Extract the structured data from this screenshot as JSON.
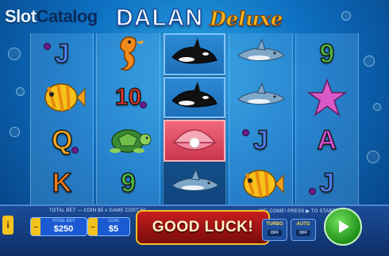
{
  "watermark": {
    "part1": "Slot",
    "part2": "Catalog"
  },
  "logo": {
    "main": "DALAN",
    "sub": "Deluxe"
  },
  "reels": [
    [
      {
        "symbol": "J",
        "type": "card",
        "class": "c-j"
      },
      {
        "symbol": "yellow-fish",
        "type": "pic"
      },
      {
        "symbol": "Q",
        "type": "card",
        "class": "c-q"
      },
      {
        "symbol": "K",
        "type": "card",
        "class": "c-k"
      }
    ],
    [
      {
        "symbol": "seahorse",
        "type": "pic"
      },
      {
        "symbol": "10",
        "type": "card",
        "class": "c-10"
      },
      {
        "symbol": "turtle",
        "type": "pic"
      },
      {
        "symbol": "9",
        "type": "card",
        "class": "c-9"
      }
    ],
    [
      {
        "symbol": "orca",
        "type": "pic"
      },
      {
        "symbol": "orca",
        "type": "pic"
      },
      {
        "symbol": "pearl-clam",
        "type": "pic"
      },
      {
        "symbol": "shark",
        "type": "pic"
      }
    ],
    [
      {
        "symbol": "shark",
        "type": "pic"
      },
      {
        "symbol": "shark",
        "type": "pic"
      },
      {
        "symbol": "J",
        "type": "card",
        "class": "c-j"
      },
      {
        "symbol": "yellow-fish",
        "type": "pic"
      }
    ],
    [
      {
        "symbol": "9",
        "type": "card",
        "class": "c-9"
      },
      {
        "symbol": "starfish",
        "type": "pic"
      },
      {
        "symbol": "A",
        "type": "card",
        "class": "c-a"
      },
      {
        "symbol": "J",
        "type": "card",
        "class": "c-j"
      }
    ]
  ],
  "hud": {
    "bet_info": "TOTAL BET — COIN $5 x GAME COST 50",
    "welcome": "WELCOME! PRESS ▶ TO START",
    "total_bet_label": "TOTAL BET",
    "total_bet_value": "$250",
    "coin_label": "COIN",
    "coin_value": "$5",
    "info_button": "i",
    "minus_button": "–",
    "message": "GOOD LUCK!",
    "turbo_label": "TURBO",
    "turbo_state": "OFF",
    "auto_label": "AUTO",
    "auto_state": "OFF"
  },
  "colors": {
    "accent_gold": "#f2c21f",
    "spin_green": "#2ea82a",
    "message_red": "#c81e1e",
    "panel_blue": "#1b4c98"
  },
  "icons": {
    "info": "info-icon",
    "spin": "play-triangle-icon"
  }
}
